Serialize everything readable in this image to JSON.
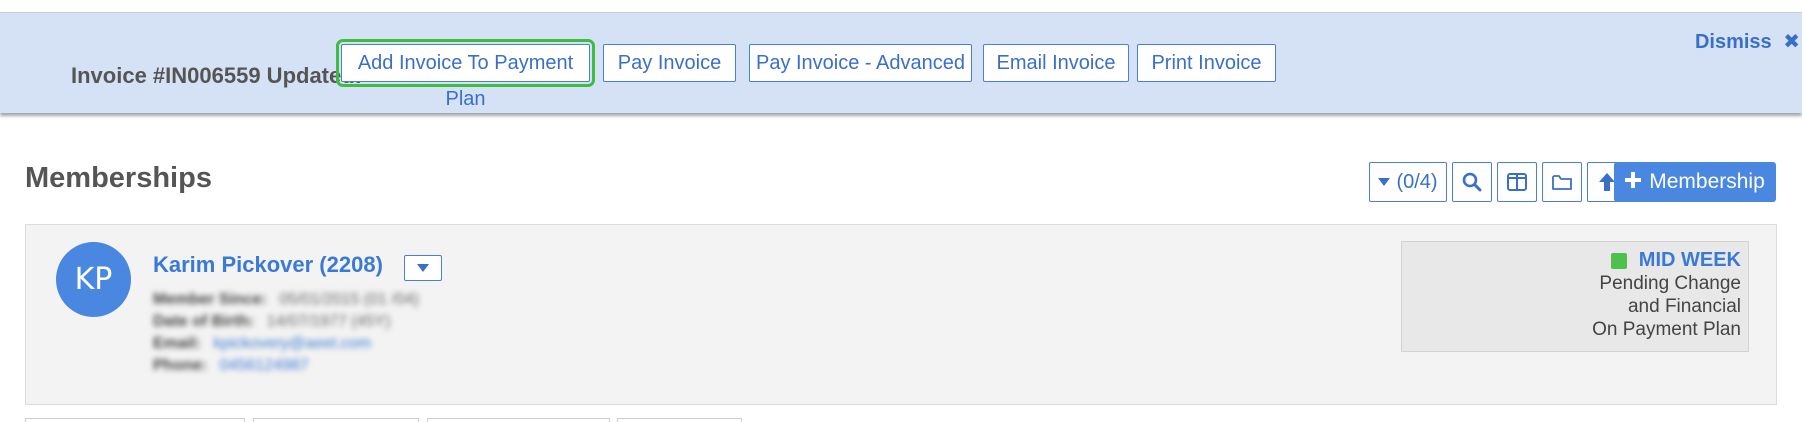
{
  "banner": {
    "title": "Invoice #IN006559 Updated:",
    "buttons": [
      "Add Invoice To Payment Plan",
      "Pay Invoice",
      "Pay Invoice - Advanced",
      "Email Invoice",
      "Print Invoice"
    ],
    "dismiss_label": "Dismiss",
    "focus_color": "#3ebd3e",
    "background": "#d5e2f5"
  },
  "section": {
    "title": "Memberships",
    "filter_label": "(0/4)",
    "add_label": "Membership",
    "toolbar_icons": [
      "search-icon",
      "columns-icon",
      "folder-icon",
      "arrow-up-icon"
    ]
  },
  "member": {
    "initials": "KP",
    "name": "Karim Pickover (2208)",
    "details": [
      {
        "label": "Member Since:",
        "value": "05/01/2015 (01 /04)"
      },
      {
        "label": "Date of Birth:",
        "value": "14/07/1977 (45Y)"
      },
      {
        "label": "Email:",
        "value": "kpickovery@aeet.com"
      },
      {
        "label": "Phone:",
        "value": "0456124987"
      }
    ],
    "status": {
      "title": "MID WEEK",
      "lines": [
        "Pending Change",
        "and Financial",
        "On Payment Plan"
      ],
      "dot_color": "#4ec04e"
    }
  },
  "colors": {
    "accent": "#4a87e0",
    "link": "#3a7ad6"
  }
}
